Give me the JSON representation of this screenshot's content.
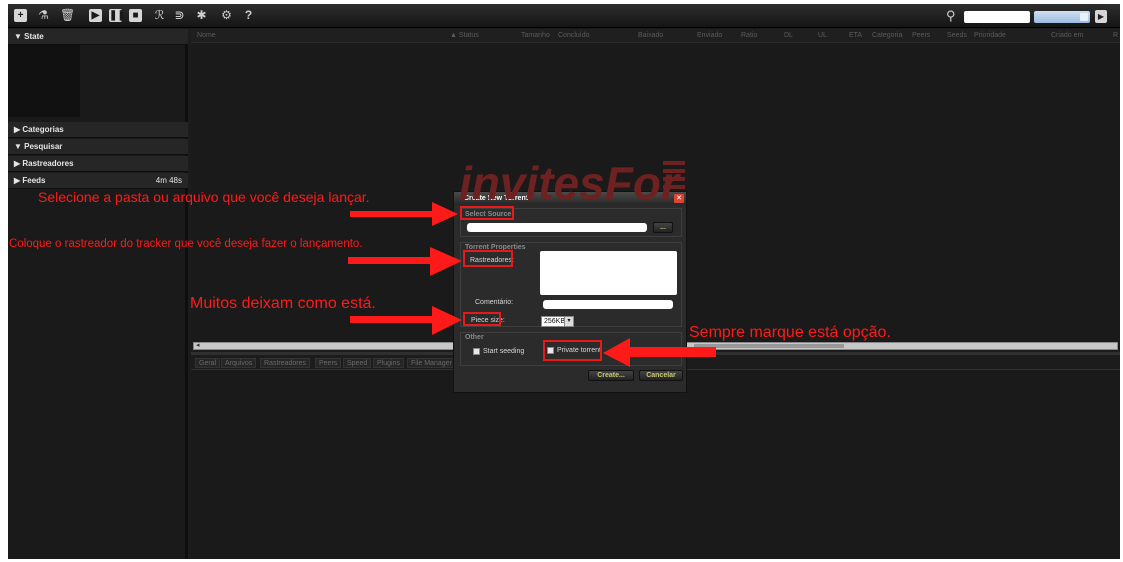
{
  "toolbar": {
    "icons": [
      "add-torrent-icon",
      "create-torrent-icon",
      "remove-icon",
      "start-icon",
      "pause-icon",
      "stop-icon",
      "rss-icon",
      "rss-feeds-icon",
      "plugins-icon",
      "settings-icon",
      "help-icon"
    ],
    "help_label": "?",
    "search_placeholder": ""
  },
  "sidebar": {
    "state_label": "▼ State",
    "categories_label": "▶ Categorias",
    "search_label": "▼ Pesquisar",
    "trackers_label": "▶ Rastreadores",
    "feeds_label": "▶ Feeds",
    "feeds_time": "4m 48s"
  },
  "list": {
    "columns": [
      "Nome",
      "▲ Status",
      "Tamanho",
      "Concluído",
      "Baixado",
      "Enviado",
      "Ratio",
      "DL",
      "UL",
      "ETA",
      "Categoria",
      "Peers",
      "Seeds",
      "Prioridade",
      "Criado em",
      "R"
    ]
  },
  "tabs": [
    "Geral",
    "Arquivos",
    "Rastreadores",
    "Peers",
    "Speed",
    "Plugins",
    "File Manager"
  ],
  "dialog": {
    "title": "Create New Torrent",
    "select_source_legend": "Select Source",
    "source_value": "",
    "browse_label": "...",
    "properties_legend": "Torrent Properties",
    "trackers_label": "Rastreadores:",
    "trackers_value": "",
    "comment_label": "Comentário:",
    "comment_value": "",
    "piece_size_label": "Piece size:",
    "piece_size_value": "256KB",
    "other_legend": "Other",
    "start_seeding_label": "Start seeding",
    "private_torrent_label": "Private torrent",
    "create_label": "Create...",
    "cancel_label": "Cancelar"
  },
  "watermark": {
    "text": "invitesFor",
    "side_text": "ME"
  },
  "annotations": {
    "source_note": "Selecione a pasta ou arquivo que você deseja lançar.",
    "tracker_note": "Coloque o rastreador do tracker que você deseja fazer o lançamento.",
    "piece_note": "Muitos deixam como está.",
    "private_note": "Sempre marque está opção.",
    "color": "#ff1a1a"
  }
}
